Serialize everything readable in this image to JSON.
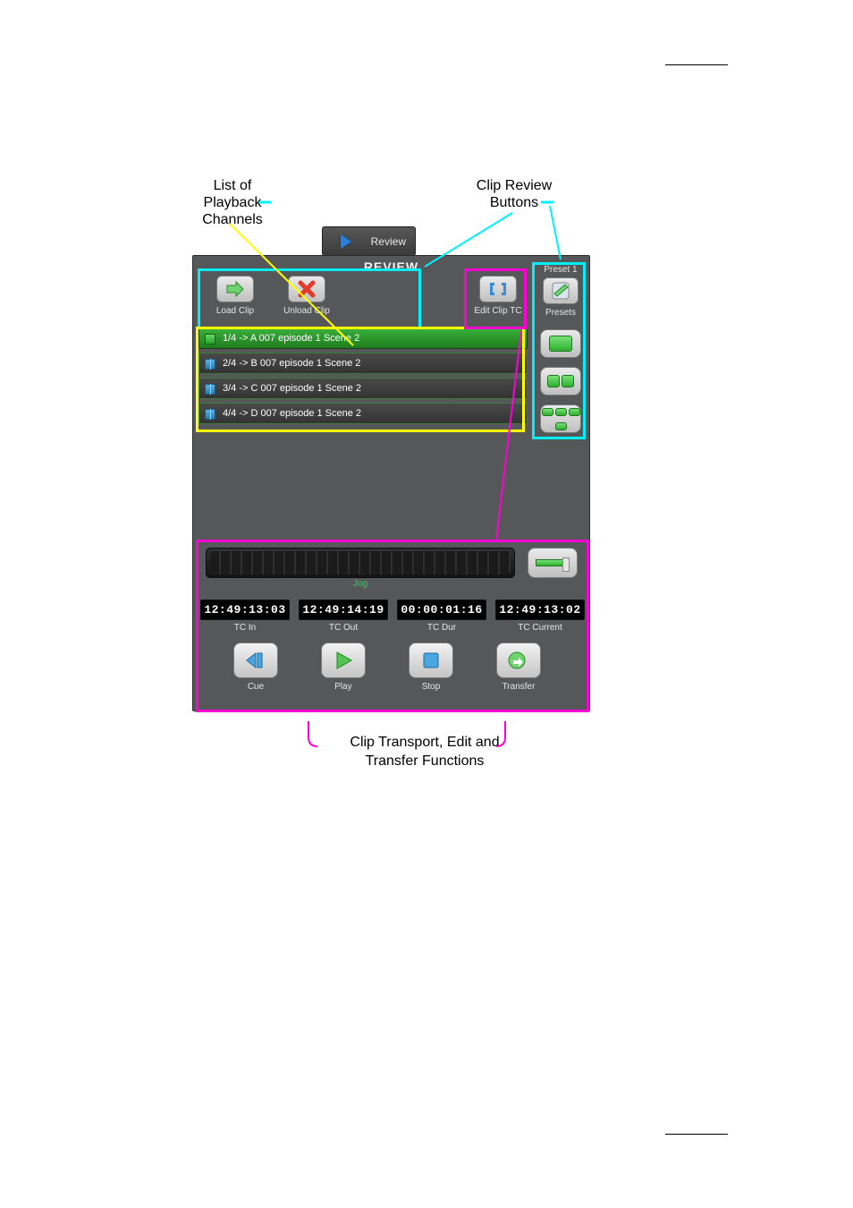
{
  "annotations": {
    "playback_channels": "List of\nPlayback\nChannels",
    "clip_review_buttons": "Clip Review\nButtons",
    "transport_functions": "Clip Transport, Edit and\nTransfer Functions"
  },
  "review_tab": {
    "label": "Review"
  },
  "panel": {
    "title": "REVIEW",
    "load_clip": "Load Clip",
    "unload_clip": "Unload Clip",
    "edit_clip_tc": "Edit Clip TC",
    "preset_index": "Preset 1",
    "presets": "Presets"
  },
  "channels": [
    {
      "label": "1/4 -> A 007 episode 1 Scene 2"
    },
    {
      "label": "2/4 -> B 007 episode 1 Scene 2"
    },
    {
      "label": "3/4 -> C 007 episode 1 Scene 2"
    },
    {
      "label": "4/4 -> D 007 episode 1 Scene 2"
    }
  ],
  "jog": {
    "label": "Jog"
  },
  "timecodes": {
    "tc_in": {
      "value": "12:49:13:03",
      "label": "TC In"
    },
    "tc_out": {
      "value": "12:49:14:19",
      "label": "TC Out"
    },
    "tc_dur": {
      "value": "00:00:01:16",
      "label": "TC Dur"
    },
    "tc_current": {
      "value": "12:49:13:02",
      "label": "TC Current"
    }
  },
  "transport": {
    "cue": "Cue",
    "play": "Play",
    "stop": "Stop",
    "transfer": "Transfer"
  }
}
